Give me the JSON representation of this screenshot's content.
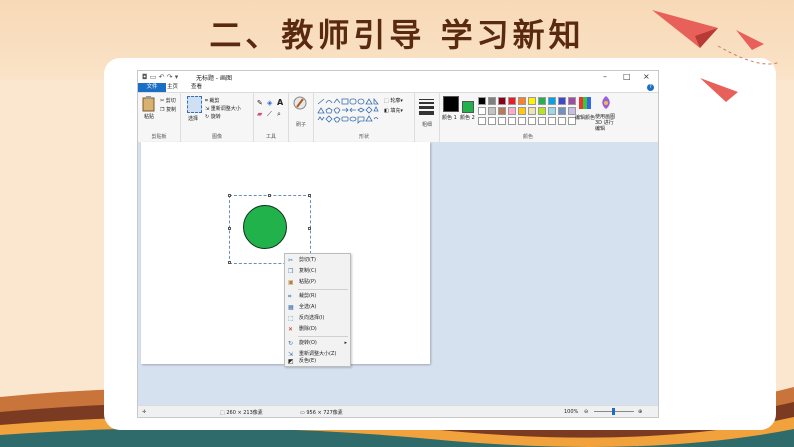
{
  "slide": {
    "title": "二、教师引导  学习新知"
  },
  "paint": {
    "window_title": "无标题 - 画图",
    "menu": {
      "file": "文件",
      "home": "主页",
      "view": "查看"
    },
    "groups": {
      "clipboard": {
        "label": "剪贴板",
        "paste": "粘贴",
        "cut": "剪切",
        "copy": "复制"
      },
      "image": {
        "label": "图像",
        "select": "选择",
        "crop": "裁剪",
        "resize": "重新调整大小",
        "rotate": "旋转"
      },
      "tools": {
        "label": "工具"
      },
      "brushes": {
        "label": "刷子"
      },
      "shapes": {
        "label": "形状",
        "outline": "轮廓",
        "fill": "填充"
      },
      "size": {
        "label": "粗细"
      },
      "colors": {
        "label": "颜色",
        "color1": "颜色 1",
        "color2": "颜色 2",
        "edit": "编辑颜色",
        "paint3d": "使用画图 3D 进行编辑"
      }
    },
    "palette": [
      "#000000",
      "#7f7f7f",
      "#880015",
      "#ed1c24",
      "#ff7f27",
      "#fff200",
      "#22b14c",
      "#00a2e8",
      "#3f48cc",
      "#a349a4",
      "#ffffff",
      "#c3c3c3",
      "#b97a57",
      "#ffaec9",
      "#ffc90e",
      "#efe4b0",
      "#b5e61d",
      "#99d9ea",
      "#7092be",
      "#c8bfe7"
    ],
    "context_menu": [
      "剪切(T)",
      "复制(C)",
      "粘贴(P)",
      "裁剪(R)",
      "全选(A)",
      "反向选择(I)",
      "删除(D)",
      "旋转(O)",
      "重新调整大小(Z)",
      "反色(E)"
    ],
    "status": {
      "selection_size": "260 × 213像素",
      "canvas_size": "956 × 727像素",
      "zoom": "100%"
    },
    "colors": {
      "shape_fill": "#21b24b",
      "accent": "#1a6fc4"
    }
  }
}
